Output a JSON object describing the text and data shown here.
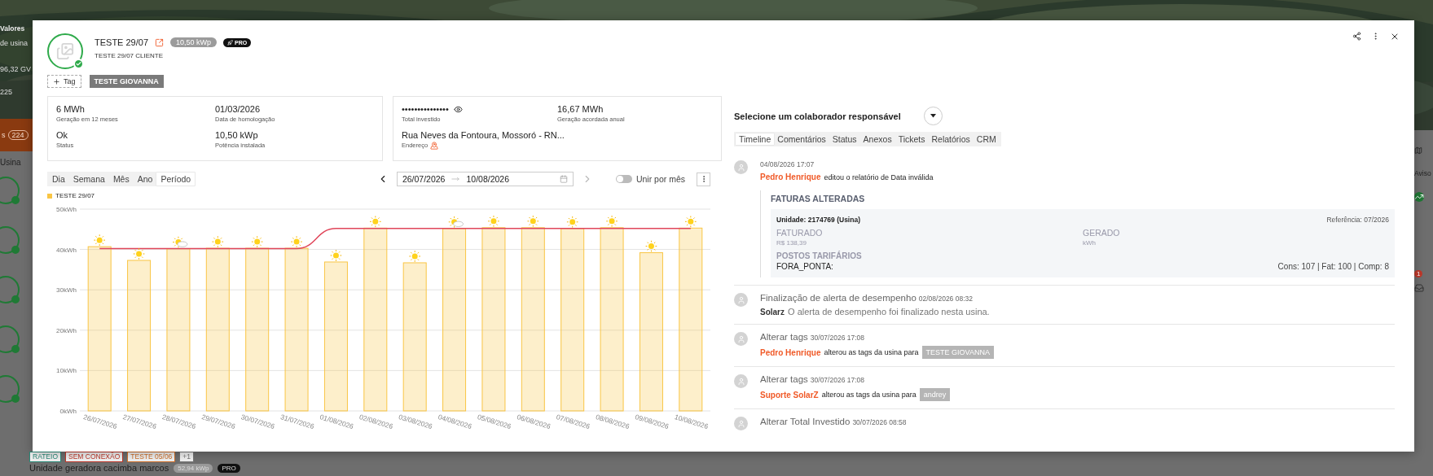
{
  "background": {
    "left_texts": [
      "Valores",
      "de usina",
      "96,32 GV",
      "225"
    ],
    "bar_label": "s",
    "bar_count": "224",
    "list_header": "Usina",
    "tags": [
      {
        "label": "RATEIO",
        "color": "#2a8c7a"
      },
      {
        "label": "SEM CONEXÃO",
        "color": "#c0392b"
      },
      {
        "label": "TESTE 05/06",
        "color": "#d0702a"
      },
      {
        "label": "+1",
        "color": "#777777"
      }
    ],
    "next_title": "Unidade geradora cacimba marcos",
    "next_power": "52,94 kWp",
    "next_badge": "PRO",
    "right_label": "Aviso",
    "notification_count": "1"
  },
  "plant": {
    "title": "TESTE 29/07",
    "power": "10,50 kWp",
    "plan": "PRO",
    "client": "TESTE 29/07 CLIENTE",
    "online": true,
    "add_tag": "Tag",
    "tags": [
      "TESTE GIOVANNA"
    ]
  },
  "cards": [
    {
      "fields": [
        {
          "value": "6 MWh",
          "label": "Geração em 12 meses"
        },
        {
          "value": "01/03/2026",
          "label": "Data de homologação"
        },
        {
          "value": "Ok",
          "label": "Status"
        },
        {
          "value": "10,50 kWp",
          "label": "Potência instalada"
        }
      ]
    },
    {
      "fields": [
        {
          "value": "•••••••••••••••",
          "label": "Total investido",
          "kind": "hidden"
        },
        {
          "value": "16,67 MWh",
          "label": "Geração acordada anual"
        },
        {
          "value": "Rua Neves da Fontoura, Mossoró - RN...",
          "label": "Endereço",
          "kind": "address"
        }
      ]
    }
  ],
  "periods": [
    {
      "label": "Dia",
      "selected": false
    },
    {
      "label": "Semana",
      "selected": false
    },
    {
      "label": "Mês",
      "selected": false
    },
    {
      "label": "Ano",
      "selected": false
    },
    {
      "label": "Período",
      "selected": true
    }
  ],
  "date_range": {
    "start": "26/07/2026",
    "end": "10/08/2026",
    "next_disabled": true
  },
  "merge_by_month": {
    "label": "Unir por mês",
    "on": false
  },
  "chart": {
    "weather_icons": [
      {
        "kind": "sun"
      },
      {
        "kind": "sun"
      },
      {
        "kind": "partly_cloudy"
      },
      {
        "kind": "sun"
      },
      {
        "kind": "sun"
      },
      {
        "kind": "sun"
      },
      {
        "kind": "sun"
      },
      {
        "kind": "sun"
      },
      {
        "kind": "sun"
      },
      {
        "kind": "partly_cloudy"
      },
      {
        "kind": "sun"
      },
      {
        "kind": "sun"
      },
      {
        "kind": "sun"
      },
      {
        "kind": "sun"
      },
      {
        "kind": "sun"
      },
      {
        "kind": "sun"
      }
    ],
    "chart_data": {
      "type": "bar",
      "categories": [
        "26/07/2026",
        "27/07/2026",
        "28/07/2026",
        "29/07/2026",
        "30/07/2026",
        "31/07/2026",
        "01/08/2026",
        "02/08/2026",
        "03/08/2026",
        "04/08/2026",
        "05/08/2026",
        "06/08/2026",
        "07/08/2026",
        "08/08/2026",
        "09/08/2026",
        "10/08/2026"
      ],
      "series": [
        {
          "name": "TESTE 29/07",
          "color": "#f9c544",
          "values": [
            40.7,
            37.3,
            40.2,
            40.3,
            40.3,
            40.3,
            36.9,
            45.3,
            36.7,
            45.2,
            45.4,
            45.4,
            45.2,
            45.4,
            39.2,
            45.3
          ]
        },
        {
          "type": "line",
          "color": "#e0465a",
          "values": [
            40.2,
            40.2,
            40.2,
            40.2,
            40.2,
            40.2,
            45.2,
            45.2,
            45.2,
            45.2,
            45.2,
            45.2,
            45.2,
            45.2,
            45.2,
            45.2
          ]
        }
      ],
      "grid": true,
      "ylim": [
        0,
        50
      ],
      "yticks": [
        {
          "value": 0,
          "label": "0kWh"
        },
        {
          "value": 10,
          "label": "10kWh"
        },
        {
          "value": 20,
          "label": "20kWh"
        },
        {
          "value": 30,
          "label": "30kWh"
        },
        {
          "value": 40,
          "label": "40kWh"
        },
        {
          "value": 50,
          "label": "50kWh"
        }
      ]
    }
  },
  "responsible": {
    "label": "Selecione um colaborador responsável"
  },
  "tabs": [
    {
      "label": "Timeline",
      "selected": true
    },
    {
      "label": "Comentários",
      "selected": false
    },
    {
      "label": "Status",
      "selected": false
    },
    {
      "label": "Anexos",
      "selected": false
    },
    {
      "label": "Tickets",
      "selected": false
    },
    {
      "label": "Relatórios",
      "selected": false
    },
    {
      "label": "CRM",
      "selected": false
    }
  ],
  "timeline": [
    {
      "kind": "invoice",
      "date": "04/08/2026 17:07",
      "actor": "Pedro Henrique",
      "color": "#f05a28",
      "text": "editou o relatório de Data inválida",
      "details": {
        "title": "FATURAS ALTERADAS",
        "unit": "Unidade: 2174769 (Usina)",
        "reference": "Referência: 07/2026",
        "billed_label": "FATURADO",
        "billed": "R$ 138,39",
        "generated_label": "GERADO",
        "generated": "kWh",
        "posts_title": "POSTOS TARIFÁRIOS",
        "post": "FORA_PONTA:",
        "post_values": "Cons: 107 | Fat: 100 | Comp: 8"
      }
    },
    {
      "kind": "alert",
      "title": "Finalização de alerta de desempenho",
      "date": "02/08/2026 08:32",
      "actor": "Solarz",
      "color": "#333333",
      "text": "O alerta de desempenho foi finalizado nesta usina."
    },
    {
      "kind": "tags",
      "title": "Alterar tags",
      "date": "30/07/2026 17:08",
      "actor": "Pedro Henrique",
      "color": "#f05a28",
      "text": "alterou as tags da usina para",
      "tag": "TESTE GIOVANNA"
    },
    {
      "kind": "tags",
      "title": "Alterar tags",
      "date": "30/07/2026 17:08",
      "actor": "Suporte SolarZ",
      "color": "#f05a28",
      "text": "alterou as tags da usina para",
      "tag": "andrey"
    },
    {
      "kind": "title_only",
      "title": "Alterar Total Investido",
      "date": "30/07/2026 08:58"
    }
  ]
}
